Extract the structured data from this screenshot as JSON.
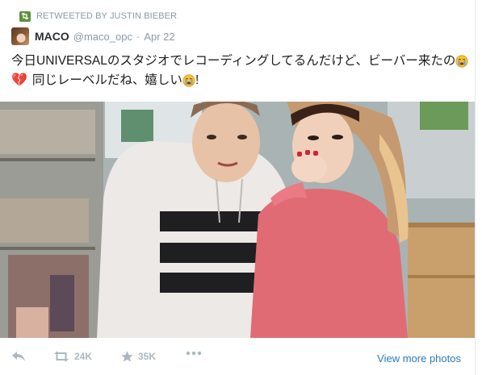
{
  "retweet": {
    "label": "RETWEETED BY JUSTIN BIEBER"
  },
  "tweet": {
    "name": "MACO",
    "handle": "@maco_opc",
    "separator": "·",
    "date": "Apr 22",
    "line1": "今日UNIVERSALのスタジオでレコーディングしてるんだけど、ビーバー来たの",
    "line2": "同じレーベルだね、嬉しい",
    "line2_end": "!"
  },
  "actions": {
    "retweets": "24K",
    "favorites": "35K",
    "view_more": "View more photos"
  },
  "colors": {
    "accent": "#2b7bb9",
    "retweet_green": "#5c913b",
    "meta_gray": "#8899a6",
    "action_gray": "#aab8c2",
    "heart_pink": "#e34b8a"
  }
}
